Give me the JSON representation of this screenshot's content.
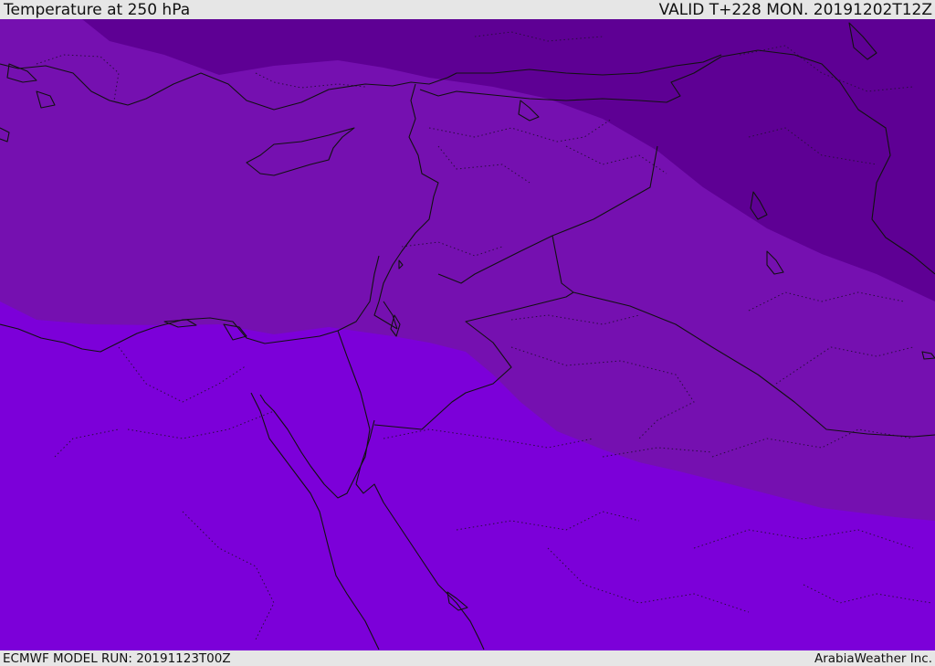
{
  "header": {
    "title": "Temperature at 250 hPa",
    "valid_time": "VALID T+228 MON. 20191202T12Z"
  },
  "footer": {
    "model_run": "ECMWF MODEL RUN: 20191123T00Z",
    "credit": "ArabiaWeather Inc."
  },
  "map": {
    "region": "Eastern Mediterranean, Egypt, Levant, Iraq and northern Arabia",
    "temperature_bands": [
      {
        "name": "coldest-band",
        "color": "#5e0094"
      },
      {
        "name": "middle-band",
        "color": "#7510b0"
      },
      {
        "name": "warmest-band",
        "color": "#7c00d9"
      }
    ],
    "border_color": "#111111",
    "admin_border_color": "#2a0c40"
  }
}
